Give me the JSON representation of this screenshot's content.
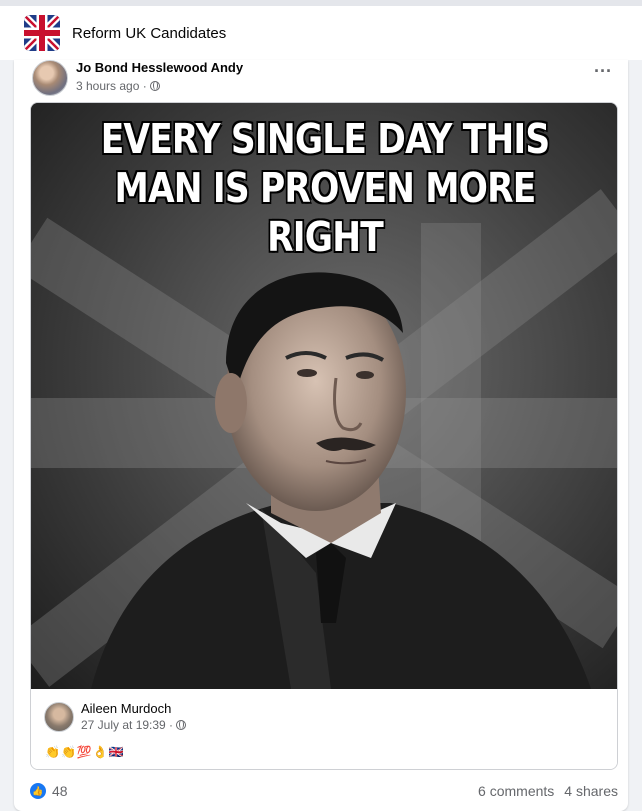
{
  "group": {
    "name": "Reform UK Candidates"
  },
  "post": {
    "author": "Jo Bond Hesslewood Andy",
    "time": "3 hours ago ·",
    "more_label": "···",
    "meme_text": "EVERY SINGLE DAY THIS\nMAN IS PROVEN MORE RIGHT"
  },
  "shared": {
    "author": "Aileen Murdoch",
    "time": "27 July at 19:39 ·",
    "emojis": "👏👏💯👌🇬🇧"
  },
  "stats": {
    "likes": "48",
    "comments": "6 comments",
    "shares": "4 shares"
  },
  "colors": {
    "accent": "#1877f2",
    "muted": "#65676b",
    "flag_blue": "#1f3c88",
    "flag_red": "#c8102e"
  },
  "icons": [
    "union-jack-icon",
    "globe-icon",
    "more-icon",
    "like-icon"
  ]
}
